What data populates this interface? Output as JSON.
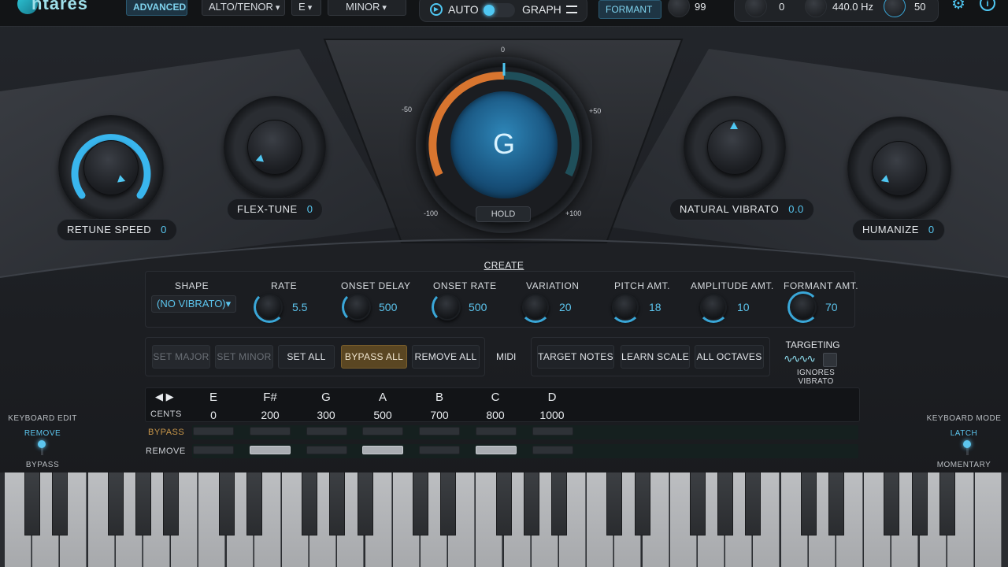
{
  "topbar": {
    "logo": "ntares",
    "advanced": "ADVANCED",
    "voice_type": "ALTO/TENOR",
    "key": "E",
    "scale": "MINOR",
    "auto": "AUTO",
    "graph": "GRAPH",
    "formant": "FORMANT",
    "formant_value": "99",
    "transpose_value": "0",
    "reference_pitch": "440.0 Hz",
    "mix_value": "50"
  },
  "knobs": {
    "retune_speed": {
      "label": "RETUNE SPEED",
      "value": "0"
    },
    "flex_tune": {
      "label": "FLEX-TUNE",
      "value": "0"
    },
    "natural_vibrato": {
      "label": "NATURAL VIBRATO",
      "value": "0.0"
    },
    "humanize": {
      "label": "HUMANIZE",
      "value": "0"
    }
  },
  "meter": {
    "note": "G",
    "tick_top": "0",
    "tick_left": "-50",
    "tick_right": "+50",
    "tick_bottom_left": "-100",
    "tick_bottom_right": "+100",
    "hold": "HOLD"
  },
  "vibrato": {
    "title": "CREATE VIBRATO",
    "shape_label": "SHAPE",
    "shape_value": "(NO VIBRATO)",
    "params": [
      {
        "label": "RATE",
        "value": "5.5"
      },
      {
        "label": "ONSET DELAY",
        "value": "500"
      },
      {
        "label": "ONSET RATE",
        "value": "500"
      },
      {
        "label": "VARIATION",
        "value": "20"
      },
      {
        "label": "PITCH AMT.",
        "value": "18"
      },
      {
        "label": "AMPLITUDE AMT.",
        "value": "10"
      },
      {
        "label": "FORMANT AMT.",
        "value": "70"
      }
    ]
  },
  "scale_buttons": {
    "set_major": "SET MAJOR",
    "set_minor": "SET MINOR",
    "set_all": "SET ALL",
    "bypass_all": "BYPASS ALL",
    "remove_all": "REMOVE ALL",
    "midi": "MIDI",
    "target_notes": "TARGET NOTES",
    "learn_scale": "LEARN SCALE",
    "all_octaves": "ALL OCTAVES",
    "targeting": "TARGETING",
    "ignores_vibrato": "IGNORES VIBRATO"
  },
  "note_table": {
    "cents_label": "CENTS",
    "bypass_label": "BYPASS",
    "remove_label": "REMOVE",
    "notes": [
      "E",
      "F#",
      "G",
      "A",
      "B",
      "C",
      "D"
    ],
    "cents": [
      "0",
      "200",
      "300",
      "500",
      "700",
      "800",
      "1000"
    ],
    "remove_on": [
      false,
      true,
      false,
      true,
      false,
      true,
      false
    ]
  },
  "keyboard_edit": {
    "title": "KEYBOARD EDIT",
    "top": "REMOVE",
    "bottom": "BYPASS"
  },
  "keyboard_mode": {
    "title": "KEYBOARD MODE",
    "top": "LATCH",
    "bottom": "MOMENTARY"
  },
  "colors": {
    "accent": "#4fc7f2",
    "orange": "#e0813a",
    "gold_button": "#5a4622"
  }
}
